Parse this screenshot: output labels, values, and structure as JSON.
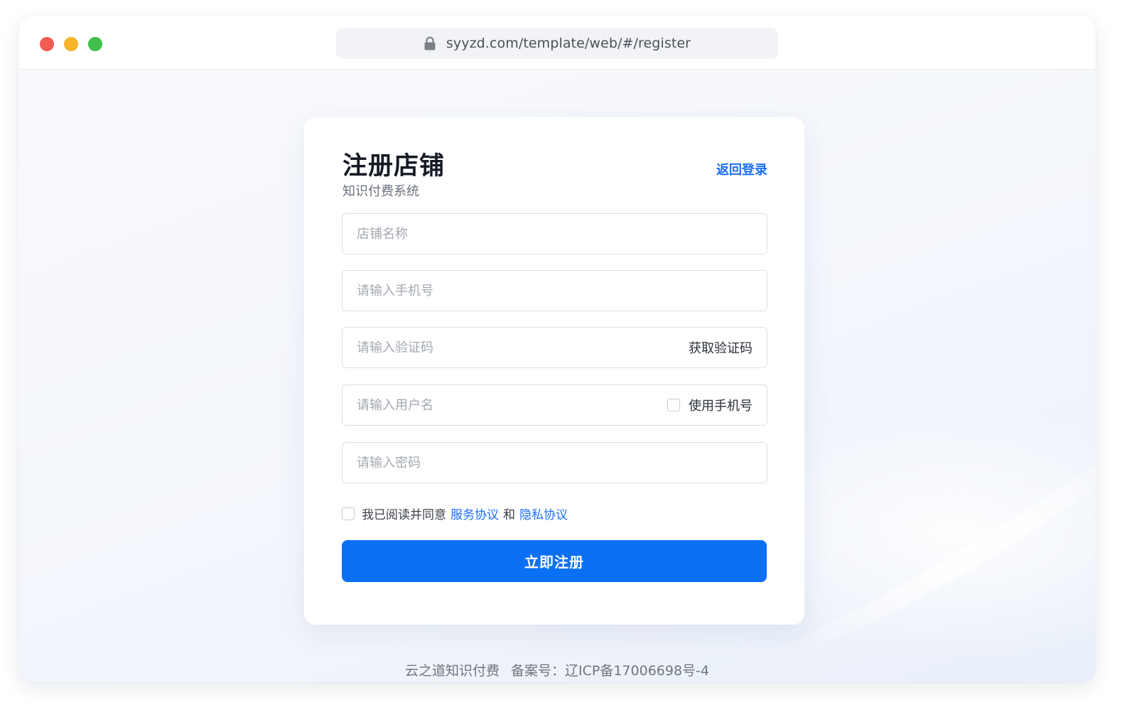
{
  "browser": {
    "url": "syyzd.com/template/web/#/register"
  },
  "form": {
    "title": "注册店铺",
    "subtitle": "知识付费系统",
    "back_login": "返回登录",
    "fields": {
      "shop_name_placeholder": "店铺名称",
      "phone_placeholder": "请输入手机号",
      "code_placeholder": "请输入验证码",
      "get_code_label": "获取验证码",
      "username_placeholder": "请输入用户名",
      "use_phone_label": "使用手机号",
      "password_placeholder": "请输入密码"
    },
    "agreement": {
      "prefix": "我已阅读并同意",
      "service_link": "服务协议",
      "conjunction": "和",
      "privacy_link": "隐私协议"
    },
    "submit_label": "立即注册"
  },
  "footer": {
    "brand": "云之道知识付费",
    "icp": "备案号：辽ICP备17006698号-4"
  },
  "colors": {
    "accent": "#0b70f4",
    "link": "#1a6ef5"
  },
  "icons": {
    "lock": "lock-icon"
  }
}
